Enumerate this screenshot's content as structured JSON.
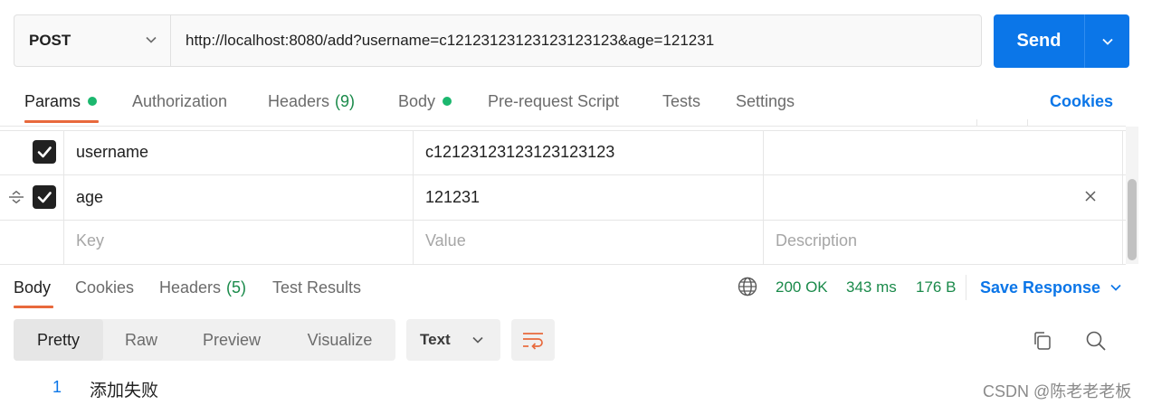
{
  "request": {
    "method": "POST",
    "url": "http://localhost:8080/add?username=c12123123123123123123&age=121231",
    "send_label": "Send"
  },
  "request_tabs": [
    {
      "label": "Params",
      "dot": true,
      "active": true
    },
    {
      "label": "Authorization"
    },
    {
      "label": "Headers",
      "count": "(9)"
    },
    {
      "label": "Body",
      "dot": true
    },
    {
      "label": "Pre-request Script"
    },
    {
      "label": "Tests"
    },
    {
      "label": "Settings"
    }
  ],
  "cookies_link": "Cookies",
  "params": {
    "rows": [
      {
        "key": "username",
        "value": "c12123123123123123123",
        "description": "",
        "checked": true
      },
      {
        "key": "age",
        "value": "121231",
        "description": "",
        "checked": true
      }
    ],
    "placeholders": {
      "key": "Key",
      "value": "Value",
      "description": "Description"
    }
  },
  "response": {
    "tabs": [
      {
        "label": "Body",
        "active": true
      },
      {
        "label": "Cookies"
      },
      {
        "label": "Headers",
        "count": "(5)"
      },
      {
        "label": "Test Results"
      }
    ],
    "status": "200 OK",
    "time": "343 ms",
    "size": "176 B",
    "save_label": "Save Response",
    "view_modes": [
      "Pretty",
      "Raw",
      "Preview",
      "Visualize"
    ],
    "format": "Text",
    "body_lines": [
      {
        "number": "1",
        "text": "添加失败"
      }
    ]
  },
  "watermark": "CSDN @陈老老老板",
  "colors": {
    "accent": "#0b76e8",
    "tab_underline": "#e8693c",
    "status_ok": "#1a8a4a",
    "dot": "#1bb76e"
  }
}
